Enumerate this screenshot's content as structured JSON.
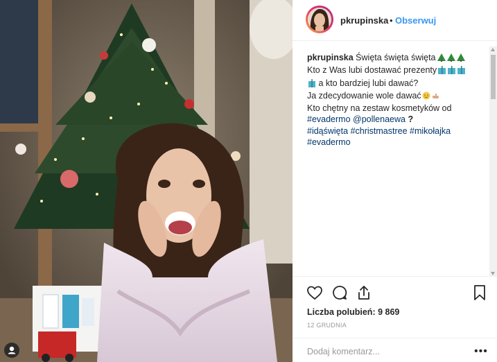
{
  "post": {
    "username": "pkrupinska",
    "separator": "•",
    "follow_label": "Obserwuj"
  },
  "caption": {
    "username": "pkrupinska",
    "line1": "Święta święta święta",
    "line2": "Kto z Was lubi dostawać prezenty",
    "line3": "a kto bardziej lubi dawać?",
    "line4": "Ja zdecydowanie wole dawać",
    "line5": "Kto chętny na zestaw kosmetyków od",
    "mention1": "#evadermo",
    "mention2": "@pollenaewa",
    "mention_suffix": "?",
    "tag1": "#idąświęta",
    "tag2": "#christmastree",
    "tag3": "#mikołajka",
    "tag4": "#evadermo"
  },
  "likes": {
    "label": "Liczba polubień:",
    "count": "9 869"
  },
  "date": "12 GRUDNIA",
  "comment": {
    "placeholder": "Dodaj komentarz..."
  },
  "more_label": "•••",
  "icons": [
    "heart-icon",
    "comment-icon",
    "share-icon",
    "bookmark-icon",
    "user-tag-icon",
    "tree-emoji",
    "gift-emoji",
    "smile-emoji",
    "hand-emoji"
  ],
  "colors": {
    "link": "#3897f0",
    "hashtag": "#003569",
    "text": "#262626",
    "muted": "#999999"
  }
}
